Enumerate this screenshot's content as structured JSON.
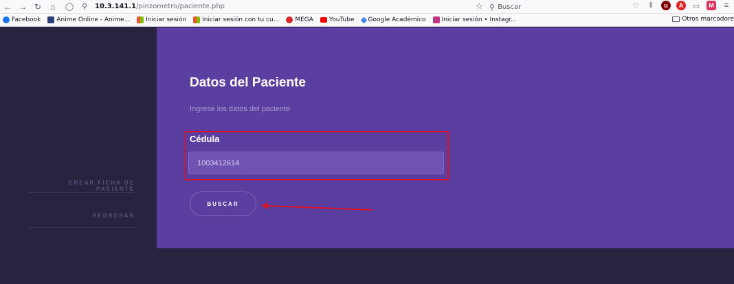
{
  "browser": {
    "url_host": "10.3.141.1",
    "url_path": "/pinzometro/paciente.php",
    "search_placeholder": "Buscar",
    "bookmarks": [
      {
        "label": "Facebook",
        "color": "#1877f2"
      },
      {
        "label": "Anime Online - Anime...",
        "color": "#2b3e7a"
      },
      {
        "label": "Iniciar sesión",
        "color": "#f35325"
      },
      {
        "label": "Iniciar sesión con tu cu...",
        "color": "#81bc06"
      },
      {
        "label": "MEGA",
        "color": "#d9272e"
      },
      {
        "label": "YouTube",
        "color": "#ff0000"
      },
      {
        "label": "Google Académico",
        "color": "#4285f4"
      },
      {
        "label": "Iniciar sesión • Instagr...",
        "color": "#c13584"
      }
    ],
    "other_bookmarks": "Otros marcadore"
  },
  "sidebar": {
    "items": [
      {
        "label": "CREAR FICHA DE PACIENTE"
      },
      {
        "label": "REGRESAR"
      }
    ]
  },
  "form": {
    "title": "Datos del Paciente",
    "subtitle": "Ingrese los datos del paciente",
    "field_label": "Cédula",
    "field_value": "1003412614",
    "button_label": "BUSCAR"
  },
  "colors": {
    "sidebar_bg": "#2a2340",
    "main_bg": "#5b3fa0",
    "annotation_red": "#d7132b"
  }
}
